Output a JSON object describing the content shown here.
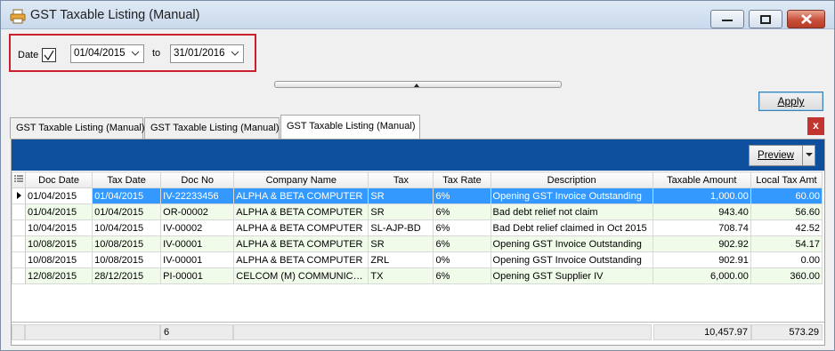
{
  "window": {
    "title": "GST Taxable Listing (Manual)"
  },
  "filter": {
    "date_label": "Date",
    "date_checked": true,
    "from": "01/04/2015",
    "to_label": "to",
    "to": "31/01/2016"
  },
  "apply_label": "Apply",
  "tabs": [
    {
      "label": "GST Taxable Listing (Manual)"
    },
    {
      "label": "GST Taxable Listing (Manual)"
    },
    {
      "label": "GST Taxable Listing (Manual)"
    }
  ],
  "close_tab_label": "x",
  "preview_label": "Preview",
  "columns": [
    "Doc Date",
    "Tax Date",
    "Doc No",
    "Company Name",
    "Tax",
    "Tax Rate",
    "Description",
    "Taxable Amount",
    "Local Tax Amt"
  ],
  "rows": [
    [
      "01/04/2015",
      "01/04/2015",
      "IV-22233456",
      "ALPHA & BETA COMPUTER",
      "SR",
      "6%",
      "Opening GST Invoice Outstanding",
      "1,000.00",
      "60.00"
    ],
    [
      "01/04/2015",
      "01/04/2015",
      "OR-00002",
      "ALPHA & BETA COMPUTER",
      "SR",
      "6%",
      "Bad debt relief not claim",
      "943.40",
      "56.60"
    ],
    [
      "10/04/2015",
      "10/04/2015",
      "IV-00002",
      "ALPHA & BETA COMPUTER",
      "SL-AJP-BD",
      "6%",
      "Bad Debt relief claimed in Oct 2015",
      "708.74",
      "42.52"
    ],
    [
      "10/08/2015",
      "10/08/2015",
      "IV-00001",
      "ALPHA & BETA COMPUTER",
      "SR",
      "6%",
      "Opening GST Invoice Outstanding",
      "902.92",
      "54.17"
    ],
    [
      "10/08/2015",
      "10/08/2015",
      "IV-00001",
      "ALPHA & BETA COMPUTER",
      "ZRL",
      "0%",
      "Opening GST Invoice Outstanding",
      "902.91",
      "0.00"
    ],
    [
      "12/08/2015",
      "28/12/2015",
      "PI-00001",
      "CELCOM (M) COMMUNICAT...",
      "TX",
      "6%",
      "Opening GST Supplier IV",
      "6,000.00",
      "360.00"
    ]
  ],
  "footer": {
    "count": "6",
    "taxable_total": "10,457.97",
    "tax_total": "573.29"
  }
}
